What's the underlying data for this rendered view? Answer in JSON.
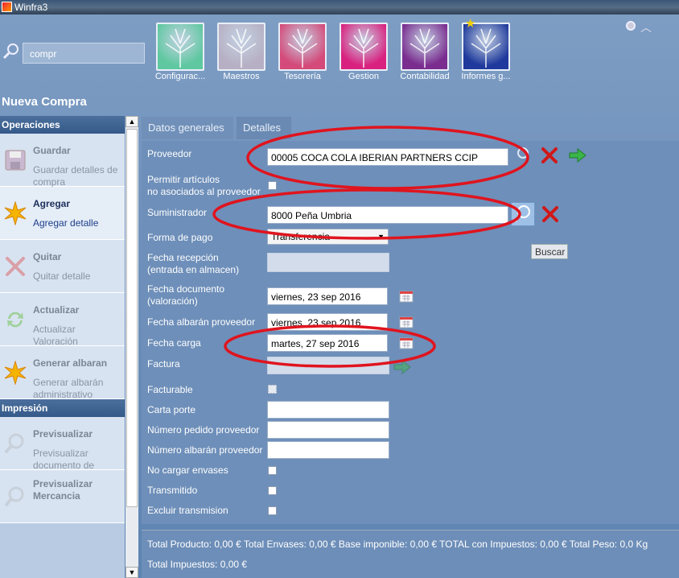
{
  "window": {
    "title": "Winfra3"
  },
  "search": {
    "value": "compr"
  },
  "modules": [
    {
      "label": "Configurac...",
      "color": "#5fc8a0",
      "icon": "tree-icon"
    },
    {
      "label": "Maestros",
      "color": "#b7b0c4",
      "icon": "tree-icon"
    },
    {
      "label": "Tesorería",
      "color": "#d44b7a",
      "icon": "tree-icon"
    },
    {
      "label": "Gestion",
      "color": "#d9227f",
      "icon": "tree-icon"
    },
    {
      "label": "Contabilidad",
      "color": "#7a2d8f",
      "icon": "tree-icon"
    },
    {
      "label": "Informes g...",
      "color": "#1f3a9c",
      "icon": "tree-icon"
    }
  ],
  "page": {
    "title": "Nueva Compra"
  },
  "sidebar": {
    "sections": [
      {
        "header": "Operaciones",
        "actions": [
          {
            "title": "Guardar",
            "subtitle": "Guardar detalles de compra",
            "icon": "save-icon",
            "active": false
          },
          {
            "title": "Agregar",
            "subtitle": "Agregar detalle",
            "icon": "star-burst-icon",
            "active": true
          },
          {
            "title": "Quitar",
            "subtitle": "Quitar detalle",
            "icon": "remove-x-icon",
            "active": false
          },
          {
            "title": "Actualizar",
            "subtitle": "Actualizar Valoración",
            "icon": "refresh-icon",
            "active": false
          },
          {
            "title": "Generar albaran",
            "subtitle": "Generar albarán administrativo",
            "icon": "star-burst-icon",
            "active": false
          }
        ]
      },
      {
        "header": "Impresión",
        "actions": [
          {
            "title": "Previsualizar",
            "subtitle": "Previsualizar documento de compra",
            "icon": "magnifier-icon",
            "active": false
          },
          {
            "title": "Previsualizar Mercancia",
            "subtitle": "",
            "icon": "magnifier-icon",
            "active": false
          }
        ]
      }
    ]
  },
  "tabs": [
    {
      "label": "Datos generales"
    },
    {
      "label": "Detalles"
    }
  ],
  "form": {
    "proveedor": {
      "label": "Proveedor",
      "value": "00005 COCA COLA IBERIAN PARTNERS CCIP"
    },
    "permitir": {
      "label": "Permitir artículos\nno asociados al proveedor"
    },
    "suministrador": {
      "label": "Suministrador",
      "value": "8000 Peña Umbria"
    },
    "forma_pago": {
      "label": "Forma de pago",
      "value": "Transferencia"
    },
    "fecha_recepcion": {
      "label": "Fecha recepción\n(entrada en almacen)"
    },
    "fecha_documento": {
      "label": "Fecha documento\n(valoración)",
      "value": "viernes, 23 sep 2016"
    },
    "fecha_albaran": {
      "label": "Fecha albarán proveedor",
      "value": "viernes, 23 sep 2016"
    },
    "fecha_carga": {
      "label": "Fecha carga",
      "value": "martes, 27 sep 2016"
    },
    "factura": {
      "label": "Factura"
    },
    "facturable": {
      "label": "Facturable"
    },
    "carta_porte": {
      "label": "Carta porte"
    },
    "num_pedido": {
      "label": "Número pedido proveedor"
    },
    "num_albaran": {
      "label": "Número albarán proveedor"
    },
    "no_cargar": {
      "label": "No cargar envases"
    },
    "transmitido": {
      "label": "Transmitido"
    },
    "excluir": {
      "label": "Excluir transmision"
    },
    "tooltip": "Buscar"
  },
  "footer": {
    "line1": "Total Producto:  0,00 €    Total Envases:  0,00 €    Base imponible:  0,00 €    TOTAL con Impuestos:  0,00 €    Total Peso:  0,0 Kg",
    "line2": "Total Impuestos:  0,00 €"
  },
  "colors": {
    "annotation": "#e0141e",
    "accent": "#1c3e8a",
    "error": "#d01818",
    "ok": "#3bb54a"
  }
}
